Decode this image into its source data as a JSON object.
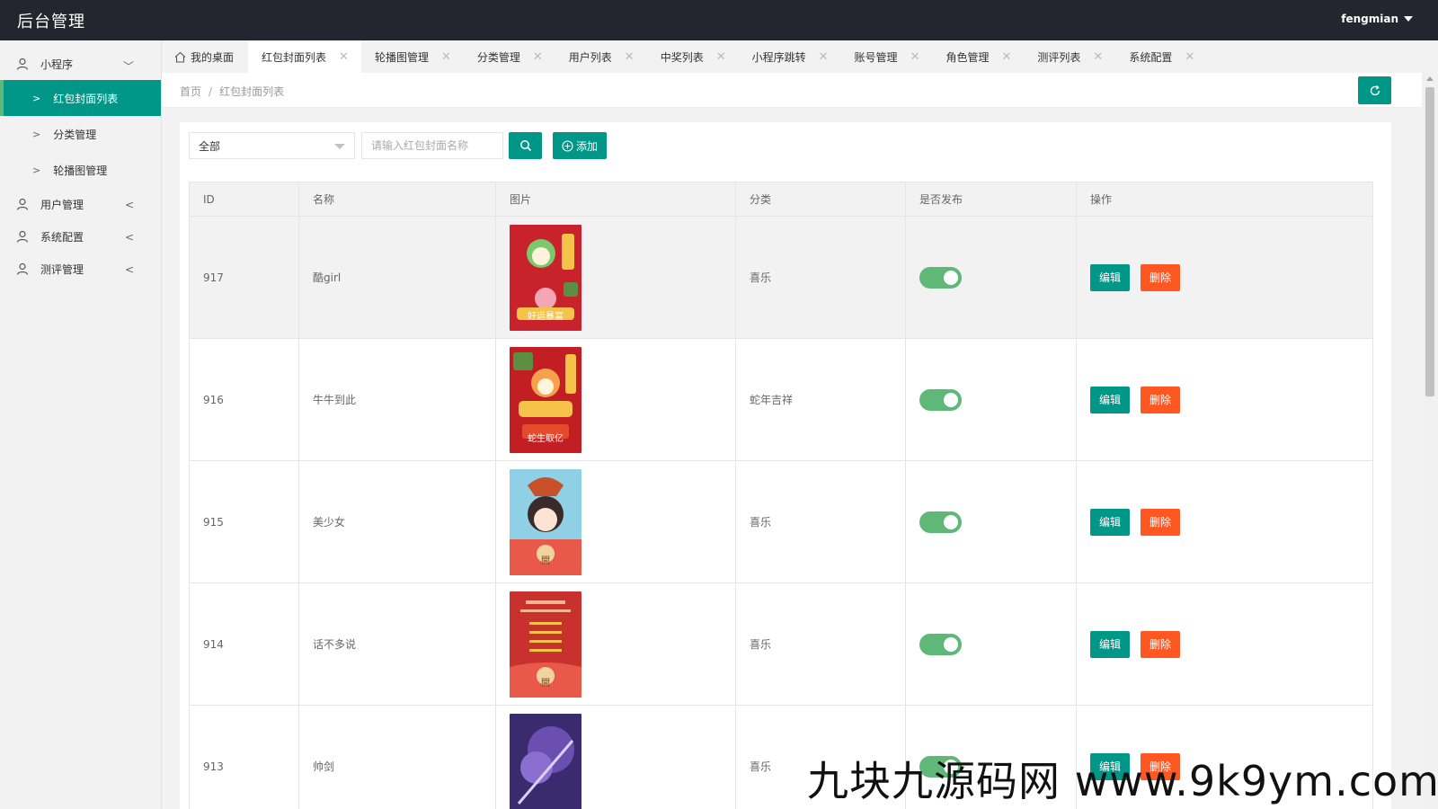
{
  "app": {
    "title": "后台管理",
    "user": "fengmian"
  },
  "sidebar": {
    "groups": [
      {
        "label": "小程序",
        "subs": [
          {
            "label": "红包封面列表",
            "active": true
          },
          {
            "label": "分类管理"
          },
          {
            "label": "轮播图管理"
          }
        ]
      },
      {
        "label": "用户管理"
      },
      {
        "label": "系统配置"
      },
      {
        "label": "测评管理"
      }
    ]
  },
  "tabs": [
    {
      "label": "我的桌面"
    },
    {
      "label": "红包封面列表",
      "active": true
    },
    {
      "label": "轮播图管理"
    },
    {
      "label": "分类管理"
    },
    {
      "label": "用户列表"
    },
    {
      "label": "中奖列表"
    },
    {
      "label": "小程序跳转"
    },
    {
      "label": "账号管理"
    },
    {
      "label": "角色管理"
    },
    {
      "label": "测评列表"
    },
    {
      "label": "系统配置"
    }
  ],
  "breadcrumb": {
    "home": "首页",
    "separator": "/",
    "current": "红包封面列表"
  },
  "toolbar": {
    "filter_value": "全部",
    "search_placeholder": "请输入红包封面名称",
    "add_label": "添加"
  },
  "table": {
    "headers": [
      "ID",
      "名称",
      "图片",
      "分类",
      "是否发布",
      "操作"
    ],
    "rows": [
      {
        "id": "917",
        "name": "酷girl",
        "category": "喜乐",
        "published": true,
        "image_caption": "好运暴富",
        "image_color": "#c8232c"
      },
      {
        "id": "916",
        "name": "牛牛到此",
        "category": "蛇年吉祥",
        "published": true,
        "image_caption": "蛇生取亿",
        "image_color": "#c21f24"
      },
      {
        "id": "915",
        "name": "美少女",
        "category": "喜乐",
        "published": true,
        "image_caption": "開",
        "image_color": "#8fd0e4"
      },
      {
        "id": "914",
        "name": "话不多说",
        "category": "喜乐",
        "published": true,
        "image_caption": "開",
        "image_color": "#c9312f"
      },
      {
        "id": "913",
        "name": "帅剑",
        "category": "喜乐",
        "published": true,
        "image_caption": "",
        "image_color": "#3a2a6e"
      }
    ],
    "edit_label": "编辑",
    "delete_label": "删除"
  },
  "watermark": "九块九源码网 www.9k9ym.com",
  "colors": {
    "primary": "#009688",
    "danger": "#ff5722",
    "switch_on": "#5fb878",
    "topbar": "#23262e"
  },
  "icons": {
    "home": "home-icon",
    "user": "user-icon",
    "search": "search-icon",
    "add": "plus-circle-icon",
    "refresh": "refresh-icon"
  }
}
